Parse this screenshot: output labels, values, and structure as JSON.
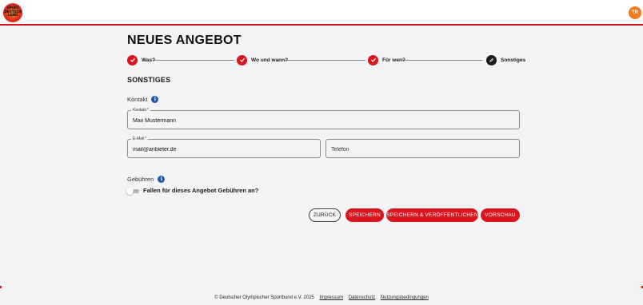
{
  "header": {
    "logo_lines": [
      "SPORT",
      "DEUTSCH",
      "LAND"
    ],
    "avatar_initials": "TR",
    "accent_color": "#d9151e"
  },
  "page": {
    "title": "NEUES ANGEBOT",
    "section_title": "SONSTIGES"
  },
  "stepper": {
    "steps": [
      {
        "label": "Was?",
        "state": "done"
      },
      {
        "label": "Wo und wann?",
        "state": "done"
      },
      {
        "label": "Für wen?",
        "state": "done"
      },
      {
        "label": "Sonstiges",
        "state": "current"
      }
    ],
    "done_icon": "check-icon",
    "current_icon": "edit-icon"
  },
  "contact": {
    "group_label": "Kontakt",
    "info_icon": "info-icon",
    "contact_field": {
      "label": "Kontakt",
      "required": "*",
      "value": "Max Mustermann"
    },
    "email_field": {
      "label": "E-Mail",
      "required": "*",
      "value": "mail@anbieter.de"
    },
    "phone_field": {
      "placeholder": "Telefon",
      "value": ""
    }
  },
  "fees": {
    "group_label": "Gebühren",
    "info_icon": "info-icon",
    "toggle_label": "Fallen für dieses Angebot Gebühren an?",
    "toggle_on": false
  },
  "actions": {
    "back": "ZURÜCK",
    "save": "SPEICHERN",
    "save_publish": "SPEICHERN & VERÖFFENTLICHEN",
    "preview": "VORSCHAU"
  },
  "footer": {
    "copyright": "© Deutscher Olympischer Sportbund e.V. 2025",
    "links": [
      "Impressum",
      "Datenschutz",
      "Nutzungsbedingungen"
    ]
  }
}
